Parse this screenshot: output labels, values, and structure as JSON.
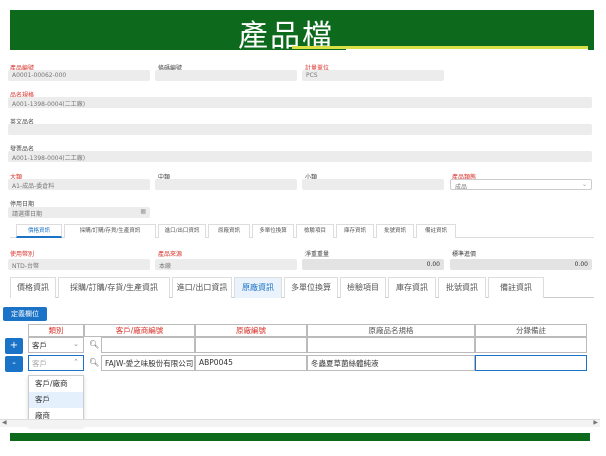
{
  "header": {
    "title": "產品檔"
  },
  "form": {
    "product_no": {
      "label": "產品編號",
      "value": "A0001-00062-000"
    },
    "barcode": {
      "label": "條碼編號",
      "value": ""
    },
    "unit": {
      "label": "計量單位",
      "value": "PCS"
    },
    "name": {
      "label": "品名規格",
      "value": "A001-1398-0004(二工廠)"
    },
    "eng_name": {
      "label": "英文品名",
      "value": ""
    },
    "invoice_name": {
      "label": "發票品名",
      "value": "A001-1398-0004(二工廠)"
    },
    "cat_large": {
      "label": "大類",
      "value": "A1-成品-委倉料"
    },
    "cat_mid": {
      "label": "中類",
      "value": ""
    },
    "cat_small": {
      "label": "小類",
      "value": ""
    },
    "prod_type": {
      "label": "產品類態",
      "value": "成品"
    },
    "disable_date": {
      "label": "停用日期",
      "placeholder": "請選擇日期"
    },
    "currency": {
      "label": "使用幣別",
      "value": "NTD-台幣"
    },
    "source": {
      "label": "產品來源",
      "value": "本廠"
    },
    "std_weight": {
      "label": "淨重重量",
      "value": "0.00"
    },
    "std_price": {
      "label": "標準進價",
      "value": "0.00"
    }
  },
  "small_tabs": [
    "價格資訊",
    "採購/訂購/存貨/生產資訊",
    "進口/出口資訊",
    "原廠資訊",
    "多單位換算",
    "檢驗項目",
    "庫存資訊",
    "批號資訊",
    "備註資訊"
  ],
  "tabs": [
    "價格資訊",
    "採購/訂購/存貨/生產資訊",
    "進口/出口資訊",
    "原廠資訊",
    "多單位換算",
    "檢驗項目",
    "庫存資訊",
    "批號資訊",
    "備註資訊"
  ],
  "active_tab": "原廠資訊",
  "define_button": "定義欄位",
  "grid": {
    "headers": [
      "類別",
      "客戶/廠商編號",
      "原廠編號",
      "原廠品名規格",
      "分錄備註"
    ],
    "add_label": "+",
    "remove_label": "-",
    "row1": {
      "category": "客戶",
      "customer": "",
      "factory_no": "",
      "spec": "",
      "note": ""
    },
    "row2": {
      "category": "客戶",
      "customer": "FAJW-愛之味股份有限公司",
      "factory_no": "ABP0045",
      "spec": "冬蟲夏草菌絲體純液",
      "note": ""
    }
  },
  "dropdown": {
    "options": [
      "客戶/廠商",
      "客戶",
      "廠商"
    ],
    "selected": "客戶"
  },
  "colors": {
    "header_green": "#0d6a1c",
    "accent_yellow": "#d8e046",
    "primary_blue": "#1a73c7",
    "required_red": "#d9332b"
  }
}
